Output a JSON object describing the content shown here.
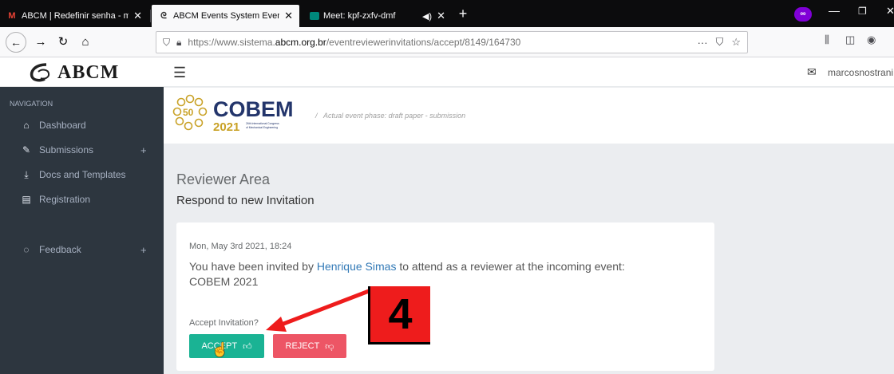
{
  "browser": {
    "tabs": [
      {
        "favicon": "gmail-icon",
        "title": "ABCM | Redefinir senha - marc",
        "active": false
      },
      {
        "favicon": "abcm-icon",
        "title": "ABCM Events System EventRev",
        "active": true
      },
      {
        "favicon": "meet-icon",
        "title": "Meet: kpf-zxfv-dmf",
        "active": false
      }
    ],
    "url": {
      "prefix": "https://www.sistema.",
      "domain": "abcm.org.br",
      "path": "/eventreviewerinvitations/accept/8149/164730"
    },
    "page_actions": "···"
  },
  "logo": {
    "text": "ABCM"
  },
  "sidebar": {
    "heading": "NAVIGATION",
    "items": [
      {
        "label": "Dashboard",
        "icon": "home-icon",
        "expandable": false
      },
      {
        "label": "Submissions",
        "icon": "pencil-icon",
        "expandable": true
      },
      {
        "label": "Docs and Templates",
        "icon": "download-icon",
        "expandable": false
      },
      {
        "label": "Registration",
        "icon": "document-icon",
        "expandable": false
      },
      {
        "label": "Feedback",
        "icon": "comment-icon",
        "expandable": true
      }
    ]
  },
  "topbar": {
    "username": "marcosnostrani"
  },
  "event": {
    "logo_anniversary": "50",
    "logo_name": "COBEM",
    "logo_year": "2021",
    "logo_caption_1": "26th International Congress",
    "logo_caption_2": "of Mechanical Engineering",
    "phase_text": "Actual event phase: draft paper - submission"
  },
  "main": {
    "title": "Reviewer Area",
    "subtitle": "Respond to new Invitation"
  },
  "invitation": {
    "date": "Mon, May 3rd 2021, 18:24",
    "text_before": "You have been invited by ",
    "inviter": "Henrique Simas",
    "text_after": " to attend as a reviewer at the incoming event:",
    "event_name": "COBEM 2021",
    "question": "Accept Invitation?",
    "accept_label": "ACCEPT",
    "reject_label": "REJECT"
  },
  "annotation": {
    "step_number": "4",
    "color": "#ee1c1c"
  },
  "colors": {
    "sidebar": "#2d363f",
    "accept": "#1ab394",
    "reject": "#ed5565",
    "link": "#337ab7"
  }
}
